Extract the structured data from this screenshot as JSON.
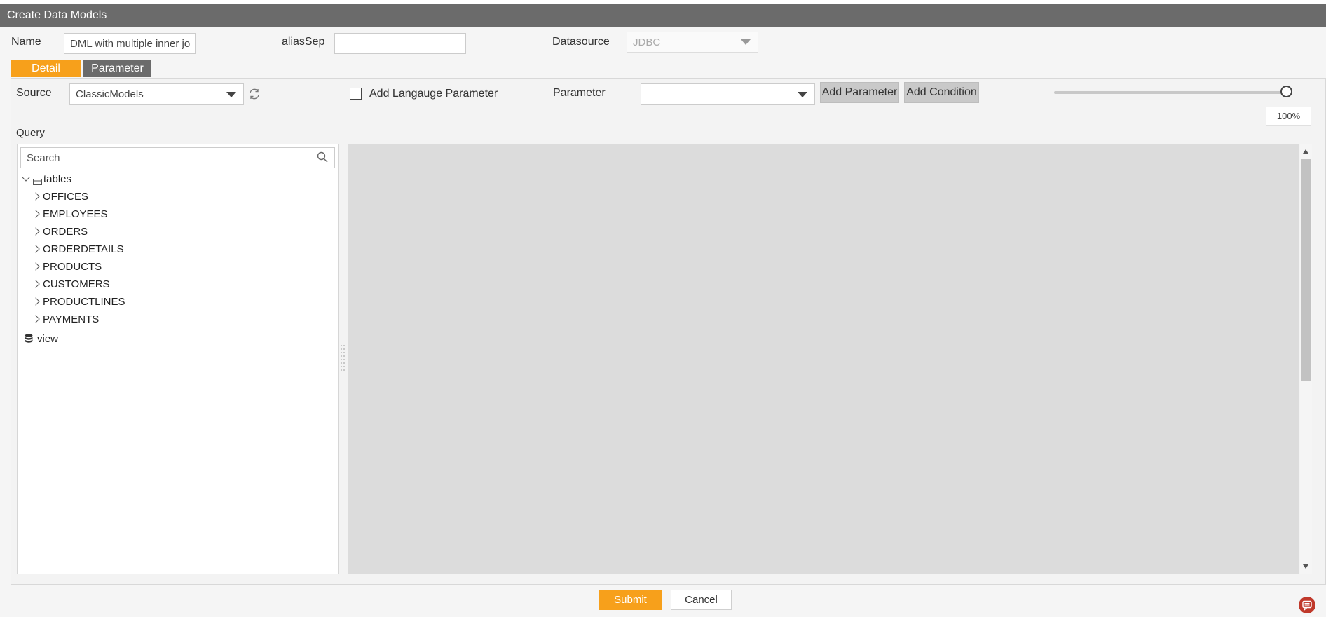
{
  "window": {
    "title": "Create Data Models"
  },
  "form": {
    "name_label": "Name",
    "name_value": "DML with multiple inner jo",
    "alias_label": "aliasSep",
    "alias_value": "",
    "datasource_label": "Datasource",
    "datasource_value": "JDBC"
  },
  "tabs": [
    {
      "label": "Detail",
      "active": true
    },
    {
      "label": "Parameter",
      "active": false
    }
  ],
  "detail": {
    "source_label": "Source",
    "source_value": "ClassicModels",
    "lang_param_label": "Add Langauge Parameter",
    "lang_param_checked": false,
    "parameter_label": "Parameter",
    "parameter_value": "",
    "add_parameter_label": "Add Parameter",
    "add_condition_label": "Add Condition",
    "zoom_value": "100%",
    "zoom_fraction": 1.0,
    "query_label": "Query"
  },
  "tree": {
    "search_placeholder": "Search",
    "tables_label": "tables",
    "tables": [
      "OFFICES",
      "EMPLOYEES",
      "ORDERS",
      "ORDERDETAILS",
      "PRODUCTS",
      "CUSTOMERS",
      "PRODUCTLINES",
      "PAYMENTS"
    ],
    "view_label": "view"
  },
  "footer": {
    "submit_label": "Submit",
    "cancel_label": "Cancel"
  },
  "colors": {
    "header_bg": "#6b6b6b",
    "accent_orange": "#f7a01b",
    "tab_inactive": "#6b6b6b",
    "editor_bg": "#dcdcdc",
    "feedback_red": "#c0392b"
  }
}
